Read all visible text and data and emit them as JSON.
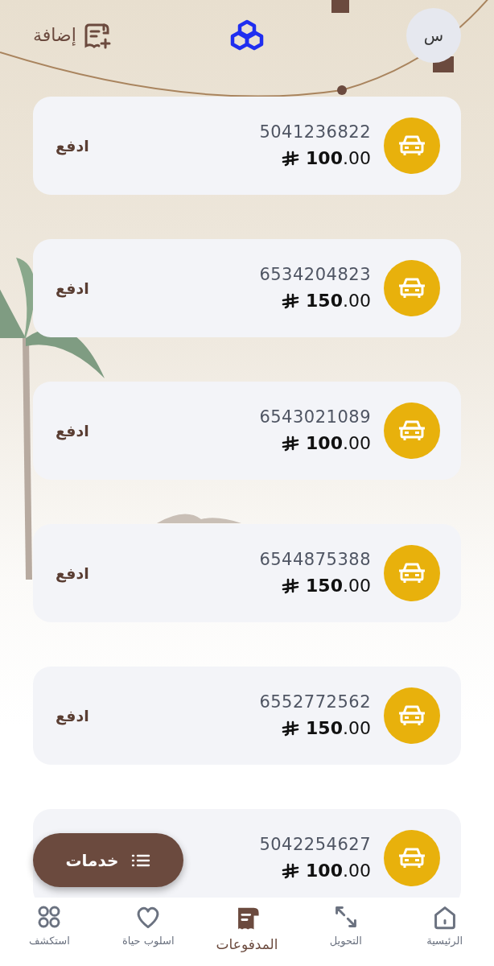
{
  "header": {
    "add_label": "إضافة",
    "avatar_initial": "س"
  },
  "payments": [
    {
      "number": "5041236822",
      "amount": "100.00",
      "action": "ادفع"
    },
    {
      "number": "6534204823",
      "amount": "150.00",
      "action": "ادفع"
    },
    {
      "number": "6543021089",
      "amount": "100.00",
      "action": "ادفع"
    },
    {
      "number": "6544875388",
      "amount": "150.00",
      "action": "ادفع"
    },
    {
      "number": "6552772562",
      "amount": "150.00",
      "action": "ادفع"
    },
    {
      "number": "5042254627",
      "amount": "100.00"
    }
  ],
  "fab": {
    "label": "خدمات"
  },
  "nav": [
    {
      "label": "الرئيسية",
      "kind": "home",
      "selected": false
    },
    {
      "label": "التحويل",
      "kind": "transfer",
      "selected": false
    },
    {
      "label": "المدفوعات",
      "kind": "bill",
      "selected": true
    },
    {
      "label": "اسلوب حياة",
      "kind": "heart",
      "selected": false
    },
    {
      "label": "استكشف",
      "kind": "grid",
      "selected": false
    }
  ]
}
